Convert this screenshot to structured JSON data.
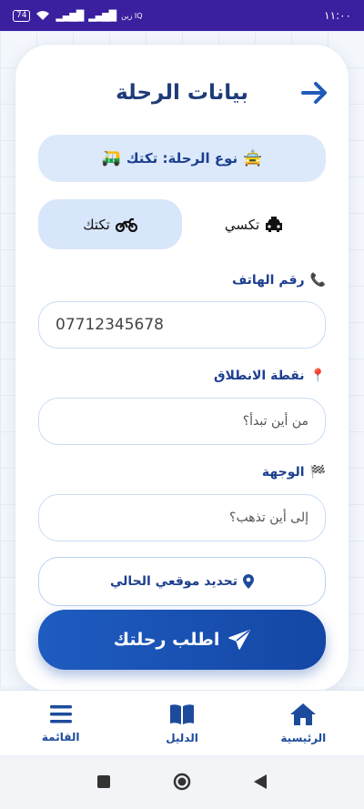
{
  "status_bar": {
    "time": "١١:٠٠",
    "battery": "74",
    "signal_1": "▂▄▆█",
    "signal_2": "▂▄▆█",
    "carrier": "زين IQ"
  },
  "header": {
    "title": "بيانات الرحلة"
  },
  "trip_type": {
    "text": "نوع الرحلة: تكتك",
    "lead_icon": "🚖",
    "trail_icon": "🛺"
  },
  "vehicle_toggle": {
    "options": [
      {
        "label": "تكسي",
        "icon": "car-icon",
        "selected": false
      },
      {
        "label": "تكتك",
        "icon": "motorcycle-icon",
        "selected": true
      }
    ]
  },
  "phone": {
    "label": "رقم الهاتف",
    "icon": "📞",
    "value": "07712345678"
  },
  "origin": {
    "label": "نقطة الانطلاق",
    "icon": "📍",
    "placeholder": "من أين تبدأ؟"
  },
  "destination": {
    "label": "الوجهة",
    "icon": "🏁",
    "placeholder": "إلى أين تذهب؟"
  },
  "locate_button": {
    "label": "تحديد موقعي الحالي"
  },
  "submit_button": {
    "label": "اطلب رحلتك"
  },
  "bottom_nav": {
    "items": [
      {
        "label": "الرئيسية",
        "icon": "home-icon"
      },
      {
        "label": "الدليل",
        "icon": "book-icon"
      },
      {
        "label": "القائمة",
        "icon": "menu-icon"
      }
    ]
  },
  "colors": {
    "primary": "#1d4b9c",
    "accent_blue": "#1e5cc0",
    "status_bar": "#3a1f9e",
    "chip_bg": "#dbe9fb"
  }
}
